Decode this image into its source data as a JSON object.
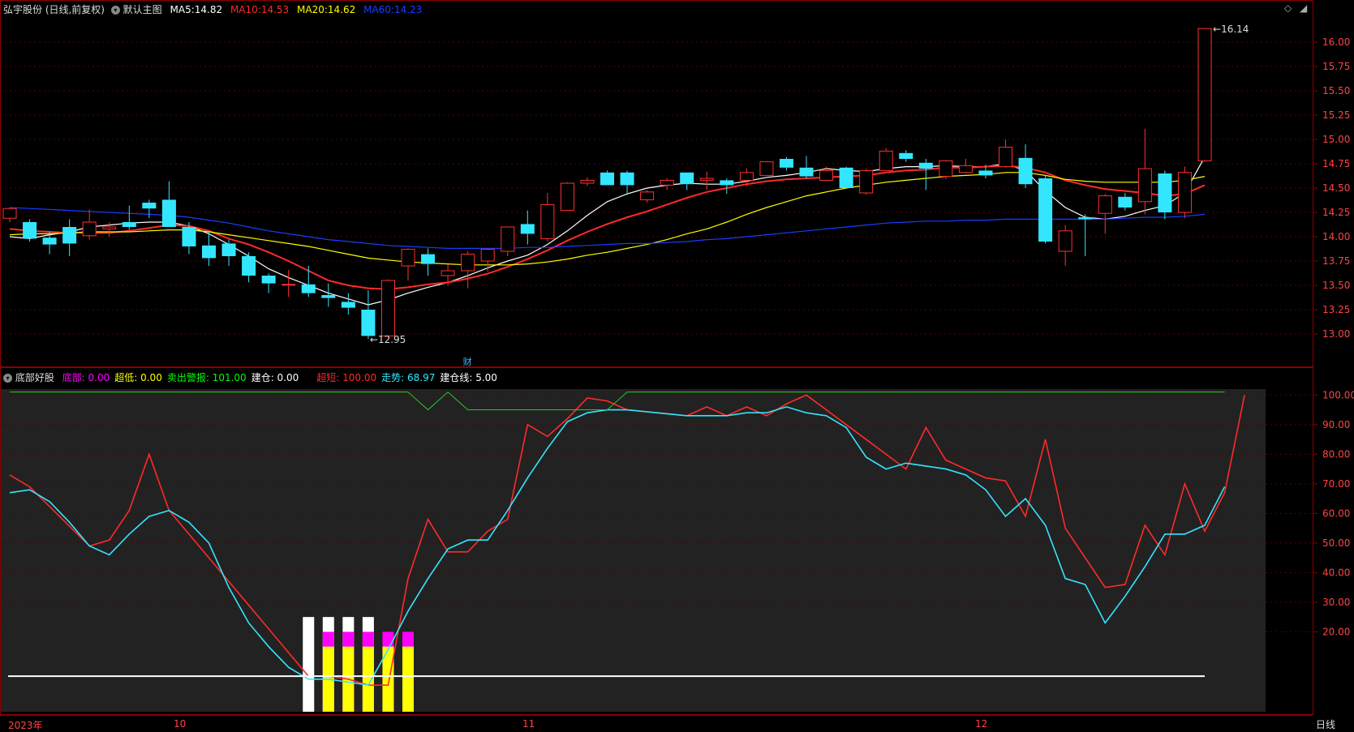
{
  "header": {
    "stock_title": "弘宇股份 (日线,前复权)",
    "main_chart_label": "默认主图",
    "ma5": {
      "label": "MA5:",
      "value": "14.82",
      "color": "#ffffff"
    },
    "ma10": {
      "label": "MA10:",
      "value": "14.53",
      "color": "#ff2a2a"
    },
    "ma20": {
      "label": "MA20:",
      "value": "14.62",
      "color": "#ffff00"
    },
    "ma60": {
      "label": "MA60:",
      "value": "14.23",
      "color": "#1a3cff"
    },
    "diamond_icon": "diamond-icon",
    "menu_icon": "caret-down-icon"
  },
  "indicator_header": {
    "name": "底部好股",
    "items": [
      {
        "label": "底部:",
        "value": "0.00",
        "color": "#ff00ff"
      },
      {
        "label": "超低:",
        "value": "0.00",
        "color": "#ffff00"
      },
      {
        "label": "卖出警报:",
        "value": "101.00",
        "color": "#00ff00"
      },
      {
        "label": "建仓:",
        "value": "0.00",
        "color": "#ffffff"
      },
      {
        "label": "超短:",
        "value": "100.00",
        "color": "#ff2a2a"
      },
      {
        "label": "走势:",
        "value": "68.97",
        "color": "#33e6ff"
      },
      {
        "label": "建仓线:",
        "value": "5.00",
        "color": "#ffffff"
      }
    ]
  },
  "annotations": {
    "high_label": "16.14",
    "low_label": "12.95",
    "cai_marker": "财"
  },
  "bottom_bar": {
    "labels": [
      "2023年",
      "10",
      "11",
      "12"
    ],
    "period_button": "日线"
  },
  "chart_data": [
    {
      "type": "candlestick",
      "price_axis": {
        "ticks": [
          "16.00",
          "15.75",
          "15.50",
          "15.25",
          "15.00",
          "14.75",
          "14.50",
          "14.25",
          "14.00",
          "13.75",
          "13.50",
          "13.25",
          "13.00"
        ],
        "ylim": [
          12.85,
          16.25
        ]
      },
      "candles": [
        {
          "o": 14.19,
          "h": 14.3,
          "l": 14.15,
          "c": 14.29
        },
        {
          "o": 14.15,
          "h": 14.18,
          "l": 13.95,
          "c": 13.98
        },
        {
          "o": 13.99,
          "h": 14.05,
          "l": 13.82,
          "c": 13.92
        },
        {
          "o": 14.1,
          "h": 14.18,
          "l": 13.8,
          "c": 13.93
        },
        {
          "o": 14.01,
          "h": 14.28,
          "l": 13.97,
          "c": 14.15
        },
        {
          "o": 14.08,
          "h": 14.15,
          "l": 14.0,
          "c": 14.1
        },
        {
          "o": 14.15,
          "h": 14.32,
          "l": 14.07,
          "c": 14.1
        },
        {
          "o": 14.35,
          "h": 14.38,
          "l": 14.19,
          "c": 14.29
        },
        {
          "o": 14.38,
          "h": 14.57,
          "l": 14.1,
          "c": 14.1
        },
        {
          "o": 14.1,
          "h": 14.15,
          "l": 13.82,
          "c": 13.9
        },
        {
          "o": 13.91,
          "h": 14.05,
          "l": 13.7,
          "c": 13.78
        },
        {
          "o": 13.93,
          "h": 13.97,
          "l": 13.7,
          "c": 13.8
        },
        {
          "o": 13.8,
          "h": 13.84,
          "l": 13.53,
          "c": 13.6
        },
        {
          "o": 13.6,
          "h": 13.62,
          "l": 13.42,
          "c": 13.52
        },
        {
          "o": 13.51,
          "h": 13.66,
          "l": 13.38,
          "c": 13.51
        },
        {
          "o": 13.51,
          "h": 13.7,
          "l": 13.38,
          "c": 13.42
        },
        {
          "o": 13.4,
          "h": 13.52,
          "l": 13.28,
          "c": 13.37
        },
        {
          "o": 13.33,
          "h": 13.42,
          "l": 13.2,
          "c": 13.27
        },
        {
          "o": 13.25,
          "h": 13.45,
          "l": 12.95,
          "c": 12.98
        },
        {
          "o": 12.98,
          "h": 13.56,
          "l": 12.97,
          "c": 13.55
        },
        {
          "o": 13.7,
          "h": 13.88,
          "l": 13.55,
          "c": 13.87
        },
        {
          "o": 13.82,
          "h": 13.88,
          "l": 13.6,
          "c": 13.72
        },
        {
          "o": 13.6,
          "h": 13.72,
          "l": 13.5,
          "c": 13.65
        },
        {
          "o": 13.65,
          "h": 13.85,
          "l": 13.47,
          "c": 13.82
        },
        {
          "o": 13.75,
          "h": 13.88,
          "l": 13.64,
          "c": 13.87
        },
        {
          "o": 13.85,
          "h": 14.1,
          "l": 13.8,
          "c": 14.1
        },
        {
          "o": 14.13,
          "h": 14.27,
          "l": 13.92,
          "c": 14.03
        },
        {
          "o": 13.98,
          "h": 14.45,
          "l": 13.95,
          "c": 14.33
        },
        {
          "o": 14.27,
          "h": 14.56,
          "l": 14.27,
          "c": 14.55
        },
        {
          "o": 14.55,
          "h": 14.61,
          "l": 14.52,
          "c": 14.58
        },
        {
          "o": 14.66,
          "h": 14.68,
          "l": 14.53,
          "c": 14.53
        },
        {
          "o": 14.66,
          "h": 14.68,
          "l": 14.43,
          "c": 14.53
        },
        {
          "o": 14.38,
          "h": 14.48,
          "l": 14.35,
          "c": 14.46
        },
        {
          "o": 14.53,
          "h": 14.6,
          "l": 14.48,
          "c": 14.58
        },
        {
          "o": 14.66,
          "h": 14.66,
          "l": 14.48,
          "c": 14.54
        },
        {
          "o": 14.58,
          "h": 14.67,
          "l": 14.48,
          "c": 14.6
        },
        {
          "o": 14.58,
          "h": 14.6,
          "l": 14.44,
          "c": 14.53
        },
        {
          "o": 14.58,
          "h": 14.7,
          "l": 14.52,
          "c": 14.66
        },
        {
          "o": 14.63,
          "h": 14.77,
          "l": 14.63,
          "c": 14.77
        },
        {
          "o": 14.8,
          "h": 14.82,
          "l": 14.68,
          "c": 14.71
        },
        {
          "o": 14.71,
          "h": 14.83,
          "l": 14.6,
          "c": 14.62
        },
        {
          "o": 14.58,
          "h": 14.72,
          "l": 14.58,
          "c": 14.68
        },
        {
          "o": 14.71,
          "h": 14.72,
          "l": 14.5,
          "c": 14.5
        },
        {
          "o": 14.45,
          "h": 14.7,
          "l": 14.43,
          "c": 14.68
        },
        {
          "o": 14.68,
          "h": 14.91,
          "l": 14.68,
          "c": 14.88
        },
        {
          "o": 14.86,
          "h": 14.89,
          "l": 14.77,
          "c": 14.8
        },
        {
          "o": 14.76,
          "h": 14.8,
          "l": 14.48,
          "c": 14.7
        },
        {
          "o": 14.62,
          "h": 14.79,
          "l": 14.59,
          "c": 14.78
        },
        {
          "o": 14.66,
          "h": 14.8,
          "l": 14.65,
          "c": 14.73
        },
        {
          "o": 14.68,
          "h": 14.74,
          "l": 14.6,
          "c": 14.63
        },
        {
          "o": 14.72,
          "h": 15.0,
          "l": 14.71,
          "c": 14.92
        },
        {
          "o": 14.81,
          "h": 14.95,
          "l": 14.5,
          "c": 14.54
        },
        {
          "o": 14.6,
          "h": 14.63,
          "l": 13.93,
          "c": 13.95
        },
        {
          "o": 13.85,
          "h": 14.12,
          "l": 13.7,
          "c": 14.06
        },
        {
          "o": 14.2,
          "h": 14.23,
          "l": 13.8,
          "c": 14.18
        },
        {
          "o": 14.24,
          "h": 14.44,
          "l": 14.03,
          "c": 14.42
        },
        {
          "o": 14.41,
          "h": 14.45,
          "l": 14.27,
          "c": 14.3
        },
        {
          "o": 14.36,
          "h": 15.11,
          "l": 14.23,
          "c": 14.7
        },
        {
          "o": 14.65,
          "h": 14.68,
          "l": 14.18,
          "c": 14.25
        },
        {
          "o": 14.25,
          "h": 14.72,
          "l": 14.19,
          "c": 14.66
        },
        {
          "o": 14.78,
          "h": 16.14,
          "l": 14.77,
          "c": 16.14
        }
      ],
      "series": [
        {
          "name": "MA5",
          "color": "#ffffff",
          "values": [
            14.0,
            13.98,
            14.02,
            14.05,
            14.1,
            14.12,
            14.14,
            14.15,
            14.15,
            14.11,
            14.03,
            13.92,
            13.8,
            13.67,
            13.58,
            13.5,
            13.42,
            13.36,
            13.3,
            13.35,
            13.42,
            13.48,
            13.53,
            13.6,
            13.68,
            13.75,
            13.81,
            13.92,
            14.06,
            14.22,
            14.36,
            14.44,
            14.5,
            14.53,
            14.55,
            14.54,
            14.54,
            14.57,
            14.61,
            14.63,
            14.66,
            14.7,
            14.68,
            14.67,
            14.7,
            14.72,
            14.72,
            14.73,
            14.72,
            14.72,
            14.75,
            14.68,
            14.47,
            14.3,
            14.2,
            14.18,
            14.21,
            14.27,
            14.32,
            14.45,
            14.82
          ]
        },
        {
          "name": "MA10",
          "color": "#ff2a2a",
          "values": [
            14.08,
            14.06,
            14.05,
            14.04,
            14.04,
            14.04,
            14.06,
            14.09,
            14.12,
            14.11,
            14.06,
            13.98,
            13.92,
            13.84,
            13.75,
            13.65,
            13.55,
            13.5,
            13.47,
            13.46,
            13.48,
            13.51,
            13.53,
            13.57,
            13.62,
            13.69,
            13.77,
            13.86,
            13.96,
            14.05,
            14.13,
            14.2,
            14.26,
            14.33,
            14.4,
            14.46,
            14.5,
            14.54,
            14.57,
            14.59,
            14.6,
            14.61,
            14.62,
            14.63,
            14.66,
            14.68,
            14.69,
            14.71,
            14.71,
            14.72,
            14.73,
            14.71,
            14.66,
            14.58,
            14.53,
            14.49,
            14.47,
            14.45,
            14.42,
            14.44,
            14.53
          ]
        },
        {
          "name": "MA20",
          "color": "#ffff00",
          "values": [
            14.02,
            14.03,
            14.03,
            14.04,
            14.05,
            14.05,
            14.05,
            14.06,
            14.07,
            14.07,
            14.05,
            14.02,
            13.99,
            13.96,
            13.93,
            13.9,
            13.86,
            13.82,
            13.78,
            13.76,
            13.74,
            13.73,
            13.72,
            13.71,
            13.71,
            13.71,
            13.72,
            13.74,
            13.77,
            13.81,
            13.84,
            13.88,
            13.92,
            13.97,
            14.03,
            14.08,
            14.15,
            14.23,
            14.3,
            14.36,
            14.42,
            14.46,
            14.5,
            14.53,
            14.56,
            14.58,
            14.6,
            14.62,
            14.63,
            14.64,
            14.66,
            14.66,
            14.63,
            14.59,
            14.57,
            14.56,
            14.56,
            14.56,
            14.56,
            14.58,
            14.62
          ]
        },
        {
          "name": "MA60",
          "color": "#1a3cff",
          "values": [
            14.3,
            14.29,
            14.28,
            14.27,
            14.26,
            14.25,
            14.24,
            14.23,
            14.22,
            14.2,
            14.17,
            14.14,
            14.1,
            14.06,
            14.03,
            14.0,
            13.97,
            13.95,
            13.93,
            13.91,
            13.9,
            13.89,
            13.88,
            13.88,
            13.88,
            13.88,
            13.89,
            13.89,
            13.9,
            13.91,
            13.92,
            13.93,
            13.93,
            13.94,
            13.95,
            13.97,
            13.98,
            14.0,
            14.02,
            14.04,
            14.06,
            14.08,
            14.1,
            14.12,
            14.14,
            14.15,
            14.16,
            14.16,
            14.17,
            14.17,
            14.18,
            14.18,
            14.18,
            14.18,
            14.18,
            14.18,
            14.19,
            14.2,
            14.2,
            14.21,
            14.23
          ]
        }
      ]
    },
    {
      "type": "line",
      "indicator_axis": {
        "ticks": [
          "100.00",
          "90.00",
          "80.00",
          "70.00",
          "60.00",
          "50.00",
          "40.00",
          "30.00",
          "20.00"
        ],
        "ylim": [
          -7,
          102
        ]
      },
      "series": [
        {
          "name": "超短",
          "color": "#ff2a2a",
          "values": [
            73,
            69,
            null,
            null,
            49,
            51,
            61,
            80,
            61,
            null,
            null,
            null,
            null,
            null,
            null,
            5,
            5,
            4,
            2,
            2,
            38,
            58,
            47,
            47,
            54,
            58,
            90,
            86,
            92,
            99,
            98,
            95,
            null,
            null,
            93,
            96,
            93,
            96,
            93,
            97,
            100,
            95,
            null,
            null,
            null,
            75,
            89,
            78,
            75,
            72,
            71,
            59,
            85,
            55,
            null,
            35,
            36,
            56,
            46,
            70,
            54,
            67,
            100
          ]
        },
        {
          "name": "走势",
          "color": "#33e6ff",
          "values": [
            67,
            68,
            64,
            57,
            49,
            46,
            53,
            59,
            61,
            57,
            50,
            35,
            23,
            15,
            8,
            4,
            4,
            3,
            2,
            14,
            27,
            38,
            48,
            51,
            51,
            61,
            72,
            82,
            91,
            94,
            95,
            95,
            null,
            null,
            93,
            93,
            93,
            94,
            94,
            96,
            94,
            93,
            89,
            79,
            75,
            77,
            76,
            75,
            73,
            68,
            59,
            65,
            56,
            38,
            36,
            23,
            32,
            42,
            53,
            53,
            56,
            69
          ]
        },
        {
          "name": "卖出警报",
          "color": "#22cc22",
          "values": [
            101,
            101,
            101,
            101,
            101,
            101,
            101,
            101,
            101,
            101,
            101,
            101,
            101,
            101,
            101,
            101,
            101,
            101,
            101,
            101,
            101,
            95,
            101,
            95,
            95,
            95,
            95,
            95,
            95,
            95,
            95,
            101,
            101,
            101,
            101,
            101,
            101,
            101,
            101,
            101,
            101,
            101,
            101,
            101,
            101,
            101,
            101,
            101,
            101,
            101,
            101,
            101,
            101,
            101,
            101,
            101,
            101,
            101,
            101,
            101,
            101,
            101
          ]
        },
        {
          "name": "建仓线",
          "color": "#ffffff",
          "values": [
            5
          ]
        }
      ],
      "bars": [
        {
          "index": 15,
          "white": 25,
          "magenta": 0,
          "yellow": 0
        },
        {
          "index": 16,
          "white": 25,
          "magenta": 20,
          "yellow": 15
        },
        {
          "index": 17,
          "white": 25,
          "magenta": 20,
          "yellow": 15
        },
        {
          "index": 18,
          "white": 25,
          "magenta": 20,
          "yellow": 15
        },
        {
          "index": 19,
          "white": 0,
          "magenta": 20,
          "yellow": 15
        },
        {
          "index": 20,
          "white": 0,
          "magenta": 20,
          "yellow": 15
        }
      ]
    }
  ]
}
